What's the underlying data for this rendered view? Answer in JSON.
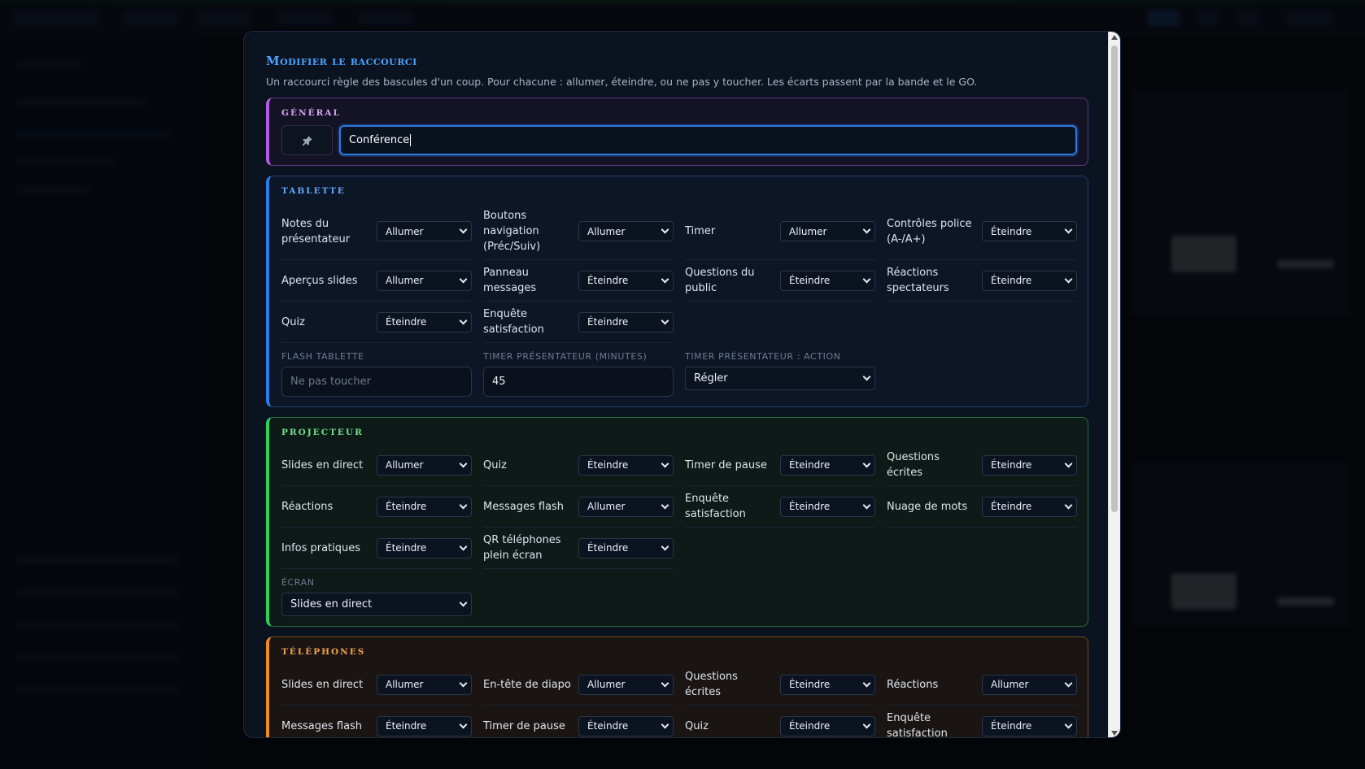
{
  "modal": {
    "title": "Modifier le raccourci",
    "description": "Un raccourci règle des bascules d'un coup. Pour chacune : allumer, éteindre, ou ne pas y toucher. Les écarts passent par la bande et le GO."
  },
  "general": {
    "title": "GÉNÉRAL",
    "icon": "pin-icon",
    "name_value": "Conférence"
  },
  "tablette": {
    "title": "TABLETTE",
    "toggles": [
      {
        "label": "Notes du présentateur",
        "value": "Allumer"
      },
      {
        "label": "Boutons navigation (Préc/Suiv)",
        "value": "Allumer"
      },
      {
        "label": "Timer",
        "value": "Allumer"
      },
      {
        "label": "Contrôles police (A-/A+)",
        "value": "Éteindre"
      },
      {
        "label": "Aperçus slides",
        "value": "Allumer"
      },
      {
        "label": "Panneau messages",
        "value": "Éteindre"
      },
      {
        "label": "Questions du public",
        "value": "Éteindre"
      },
      {
        "label": "Réactions spectateurs",
        "value": "Éteindre"
      },
      {
        "label": "Quiz",
        "value": "Éteindre"
      },
      {
        "label": "Enquête satisfaction",
        "value": "Éteindre"
      }
    ],
    "flash_label": "FLASH TABLETTE",
    "flash_placeholder": "Ne pas toucher",
    "timer_minutes_label": "TIMER PRÉSENTATEUR (MINUTES)",
    "timer_minutes_value": "45",
    "timer_action_label": "TIMER PRÉSENTATEUR : ACTION",
    "timer_action_value": "Régler"
  },
  "projecteur": {
    "title": "PROJECTEUR",
    "toggles": [
      {
        "label": "Slides en direct",
        "value": "Allumer"
      },
      {
        "label": "Quiz",
        "value": "Éteindre"
      },
      {
        "label": "Timer de pause",
        "value": "Éteindre"
      },
      {
        "label": "Questions écrites",
        "value": "Éteindre"
      },
      {
        "label": "Réactions",
        "value": "Éteindre"
      },
      {
        "label": "Messages flash",
        "value": "Allumer"
      },
      {
        "label": "Enquête satisfaction",
        "value": "Éteindre"
      },
      {
        "label": "Nuage de mots",
        "value": "Éteindre"
      },
      {
        "label": "Infos pratiques",
        "value": "Éteindre"
      },
      {
        "label": "QR téléphones plein écran",
        "value": "Éteindre"
      }
    ],
    "screen_label": "ÉCRAN",
    "screen_value": "Slides en direct"
  },
  "telephones": {
    "title": "TÉLÉPHONES",
    "toggles": [
      {
        "label": "Slides en direct",
        "value": "Allumer"
      },
      {
        "label": "En-tête de diapo",
        "value": "Allumer"
      },
      {
        "label": "Questions écrites",
        "value": "Éteindre"
      },
      {
        "label": "Réactions",
        "value": "Allumer"
      },
      {
        "label": "Messages flash",
        "value": "Éteindre"
      },
      {
        "label": "Timer de pause",
        "value": "Éteindre"
      },
      {
        "label": "Quiz",
        "value": "Éteindre"
      },
      {
        "label": "Enquête satisfaction",
        "value": "Éteindre"
      }
    ]
  }
}
